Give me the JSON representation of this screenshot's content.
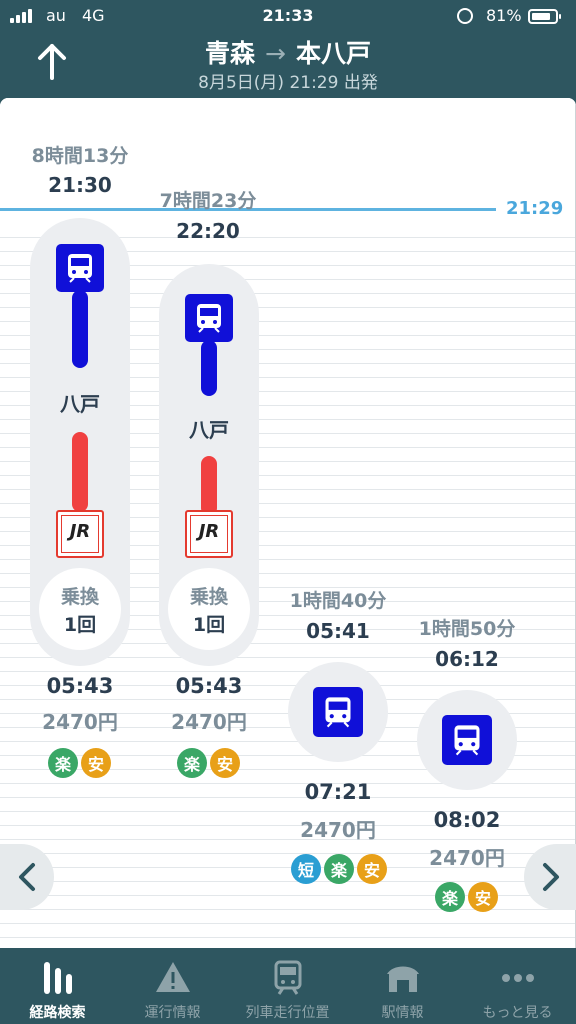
{
  "status": {
    "carrier": "au",
    "network": "4G",
    "time": "21:33",
    "battery": "81%",
    "battery_level": 0.81
  },
  "header": {
    "from": "青森",
    "arrow": "→",
    "to": "本八戸",
    "subtitle": "8月5日(月) 21:29 出発"
  },
  "now_label": "21:29",
  "routes": [
    {
      "duration": "8時間13分",
      "depart": "21:30",
      "station": "八戸",
      "transfer_label": "乗換",
      "transfer_count": "1回",
      "arrive": "05:43",
      "fare": "2470円",
      "tags": [
        "楽",
        "安"
      ],
      "jr_label": "JR"
    },
    {
      "duration": "7時間23分",
      "depart": "22:20",
      "station": "八戸",
      "transfer_label": "乗換",
      "transfer_count": "1回",
      "arrive": "05:43",
      "fare": "2470円",
      "tags": [
        "楽",
        "安"
      ],
      "jr_label": "JR"
    },
    {
      "duration": "1時間40分",
      "depart": "05:41",
      "arrive": "07:21",
      "fare": "2470円",
      "tags": [
        "短",
        "楽",
        "安"
      ]
    },
    {
      "duration": "1時間50分",
      "depart": "06:12",
      "arrive": "08:02",
      "fare": "2470円",
      "tags": [
        "楽",
        "安"
      ]
    }
  ],
  "tabs": [
    {
      "label": "経路検索",
      "icon": "route-search-icon",
      "active": true
    },
    {
      "label": "運行情報",
      "icon": "warning-icon"
    },
    {
      "label": "列車走行位置",
      "icon": "train-position-icon"
    },
    {
      "label": "駅情報",
      "icon": "station-icon"
    },
    {
      "label": "もっと見る",
      "icon": "more-icon"
    }
  ],
  "colors": {
    "header_bg": "#2e5660",
    "now_line": "#5eb3e0",
    "train_blue": "#1010d8",
    "jr_red": "#e43a2f",
    "tag_green": "#3aa766",
    "tag_orange": "#e8a018",
    "tag_blue": "#2a9ed3"
  }
}
